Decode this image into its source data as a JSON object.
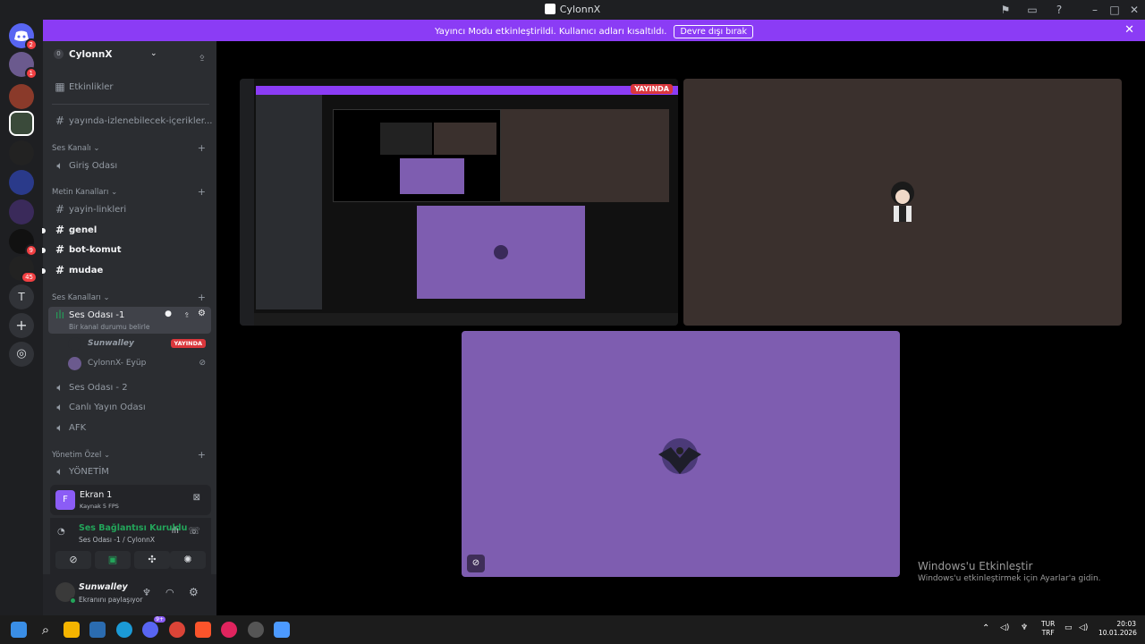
{
  "window": {
    "title": "CylonnX"
  },
  "banner": {
    "message": "Yayıncı Modu etkinleştirildi. Kullanıcı adları kısaltıldı.",
    "button": "Devre dışı bırak"
  },
  "servers": {
    "badges": [
      "2",
      "1",
      "9",
      "45"
    ],
    "text_server": "T"
  },
  "guild": {
    "name": "CylonnX",
    "boost_count": "0"
  },
  "channels": {
    "events": "Etkinlikler",
    "stream_content": "yayında-izlenebilecek-içerikler...",
    "cat_voice1": "Ses Kanalı",
    "entry_room": "Giriş Odası",
    "cat_text": "Metin Kanalları",
    "yayin_linkleri": "yayin-linkleri",
    "genel": "genel",
    "bot_komut": "bot-komut",
    "mudae": "mudae",
    "cat_voice2": "Ses Kanalları",
    "voice_room1": "Ses Odası -1",
    "voice_status": "Bir kanal durumu belirle",
    "user1": "Sunwalley",
    "user1_badge": "YAYINDA",
    "user2": "CylonnX- Eyüp",
    "voice_room2": "Ses Odası - 2",
    "live_room": "Canlı Yayın Odası",
    "afk": "AFK",
    "cat_admin": "Yönetim Özel",
    "admin_room": "YÖNETİM"
  },
  "screen_share": {
    "title": "Ekran 1",
    "sub": "Kaynak 5 FPS",
    "letter": "F"
  },
  "voice": {
    "status": "Ses Bağlantısı Kuruldu",
    "channel": "Ses Odası -1 / CylonnX"
  },
  "user": {
    "name": "Sunwalley",
    "status": "Ekranını paylaşıyor"
  },
  "stream": {
    "live_badge": "YAYINDA"
  },
  "watermark": {
    "title": "Windows'u Etkinleştir",
    "sub": "Windows'u etkinleştirmek için Ayarlar'a gidin."
  },
  "taskbar": {
    "lang1": "TUR",
    "lang2": "TRF",
    "time": "20:03",
    "date": "10.01.2026",
    "badge": "9+"
  },
  "colors": {
    "accent": "#8b3cf5",
    "green": "#23a55a",
    "red": "#da373c",
    "tile_purple": "#7e5db0",
    "tile_brown": "#3a302d"
  }
}
